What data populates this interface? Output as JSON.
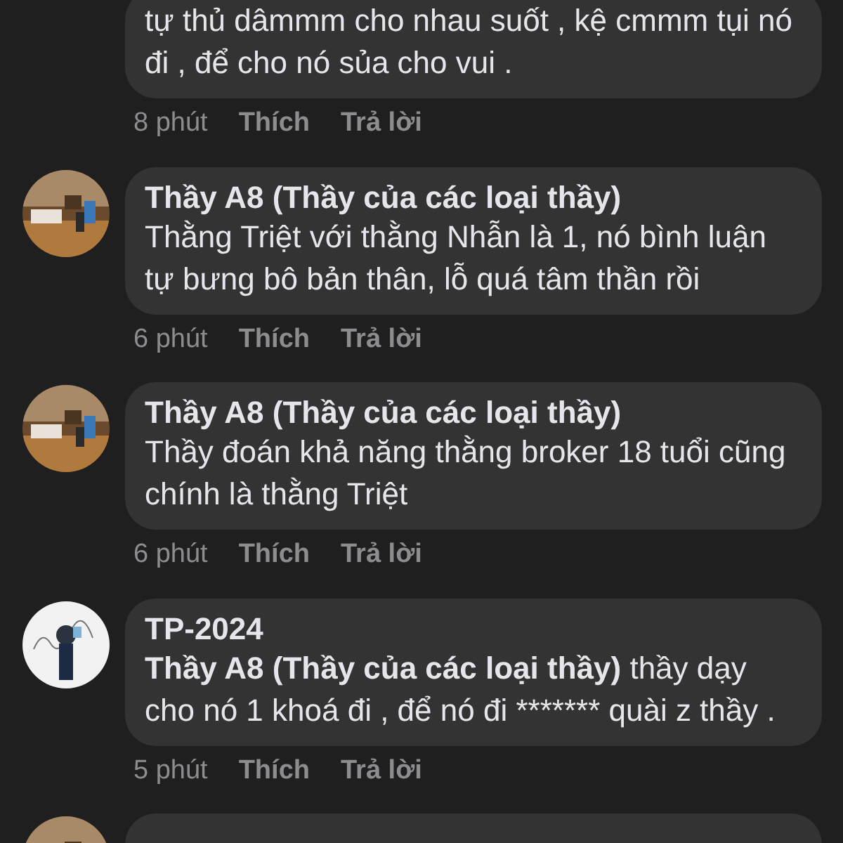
{
  "comments": [
    {
      "text": "tự thủ dâmmm cho nhau suốt , kệ cmmm tụi nó đi , để cho nó sủa cho vui .",
      "time": "8 phút",
      "like": "Thích",
      "reply": "Trả lời"
    },
    {
      "avatar": {
        "kind": "room"
      },
      "author": "Thầy A8 (Thầy của các loại thầy)",
      "text": "Thằng Triệt với thằng Nhẫn là 1, nó bình luận tự bưng bô bản thân, lỗ quá tâm thần rồi",
      "time": "6 phút",
      "like": "Thích",
      "reply": "Trả lời"
    },
    {
      "avatar": {
        "kind": "room"
      },
      "author": "Thầy A8 (Thầy của các loại thầy)",
      "text": "Thầy đoán khả năng thằng broker 18 tuổi cũng chính là thằng Triệt",
      "time": "6 phút",
      "like": "Thích",
      "reply": "Trả lời"
    },
    {
      "avatar": {
        "kind": "figure"
      },
      "author": "TP-2024",
      "mention": "Thầy A8 (Thầy của các loại thầy)",
      "text": "thầy dạy cho nó 1 khoá đi , để nó đi ******* quài z thầy .",
      "time": "5 phút",
      "like": "Thích",
      "reply": "Trả lời"
    },
    {
      "avatar": {
        "kind": "room"
      }
    }
  ]
}
